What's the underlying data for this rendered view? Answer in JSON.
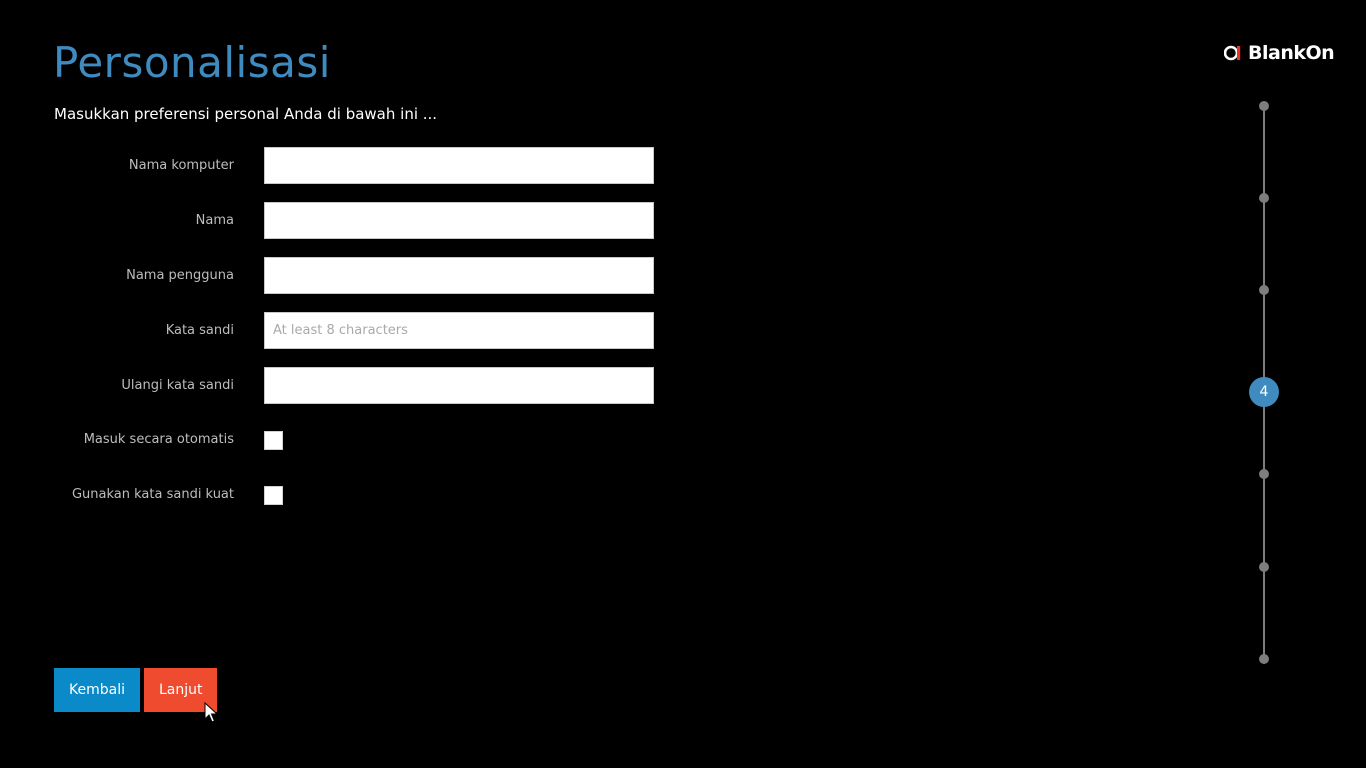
{
  "header": {
    "title": "Personalisasi",
    "subtitle": "Masukkan preferensi personal Anda di bawah ini ..."
  },
  "logo": {
    "text": "BlankOn",
    "accent_color": "#e8352b"
  },
  "form": {
    "fields": [
      {
        "label": "Nama komputer",
        "value": "",
        "placeholder": ""
      },
      {
        "label": "Nama",
        "value": "",
        "placeholder": ""
      },
      {
        "label": "Nama pengguna",
        "value": "",
        "placeholder": ""
      },
      {
        "label": "Kata sandi",
        "value": "",
        "placeholder": "At least 8 characters"
      },
      {
        "label": "Ulangi kata sandi",
        "value": "",
        "placeholder": ""
      }
    ],
    "checkboxes": [
      {
        "label": "Masuk secara otomatis",
        "checked": false
      },
      {
        "label": "Gunakan kata sandi kuat",
        "checked": false
      }
    ]
  },
  "buttons": {
    "back_label": "Kembali",
    "next_label": "Lanjut"
  },
  "stepper": {
    "total_steps": 7,
    "current_step": "4"
  },
  "colors": {
    "background": "#000000",
    "title": "#3f8bbf",
    "back_button": "#0a8ac9",
    "next_button": "#ef4b2e",
    "stepper_active": "#3f8bbf",
    "stepper_inactive": "#7d7d7d"
  }
}
